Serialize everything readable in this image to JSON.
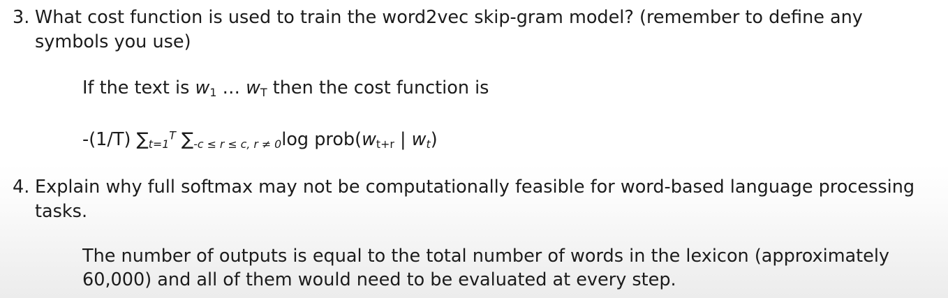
{
  "q3": {
    "number": "3.",
    "text_line1": "What cost function is used to train the word2vec skip-gram model? (remember to define any",
    "text_line2": "symbols you use)"
  },
  "a3": {
    "line1_prefix": "If the text is ",
    "w": "w",
    "sub_1": "1",
    "ellipsis": " … ",
    "sub_T": "T",
    "line1_suffix": " then the cost function is",
    "formula_lead": "-(1/T) ",
    "sum1": "∑",
    "sum1_sub": "t=1",
    "sum1_sup": "T",
    "sum2": "∑",
    "sum2_sub": "-c ≤ r ≤ c, r ≠ 0",
    "log_prob": "log prob(",
    "sub_tplusr": "t+r",
    "bar": " | ",
    "sub_t": "t",
    "close": ")"
  },
  "q4": {
    "number": "4.",
    "text_line1": "Explain why full softmax may not be computationally feasible for word-based language processing",
    "text_line2": "tasks."
  },
  "a4": {
    "line1": "The number of outputs is equal to the total number of words in the lexicon (approximately",
    "line2": "60,000) and all of them would need to be evaluated at every step."
  }
}
